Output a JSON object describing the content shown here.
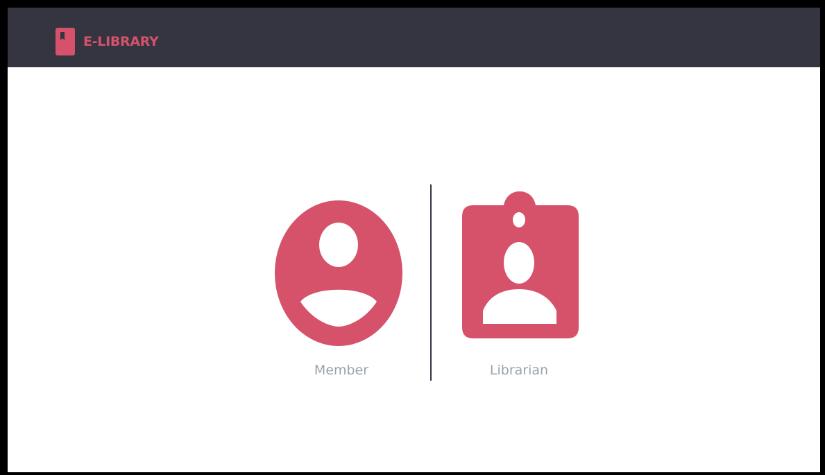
{
  "app": {
    "brand_name": "E-LIBRARY",
    "brand_icon": "book-bookmark-icon"
  },
  "roles": [
    {
      "label": "Member",
      "icon": "account-circle-icon"
    },
    {
      "label": "Librarian",
      "icon": "badge-id-icon"
    }
  ],
  "colors": {
    "accent": "#d5526a",
    "navbar": "#343541",
    "label": "#9aa3ab",
    "background": "#ffffff"
  }
}
